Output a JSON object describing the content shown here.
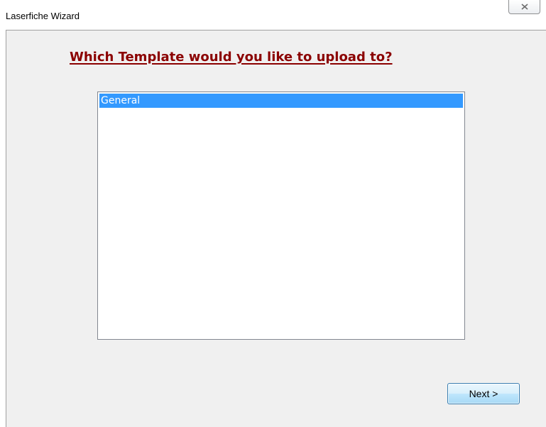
{
  "window": {
    "title": "Laserfiche Wizard",
    "close_icon": "close-icon"
  },
  "main": {
    "heading": "Which Template would you like to upload to?",
    "templates": [
      {
        "label": "General",
        "selected": true
      }
    ],
    "next_label": "Next >"
  },
  "colors": {
    "heading": "#8b0000",
    "selection": "#3399ff",
    "client_background": "#f0f0f0"
  }
}
